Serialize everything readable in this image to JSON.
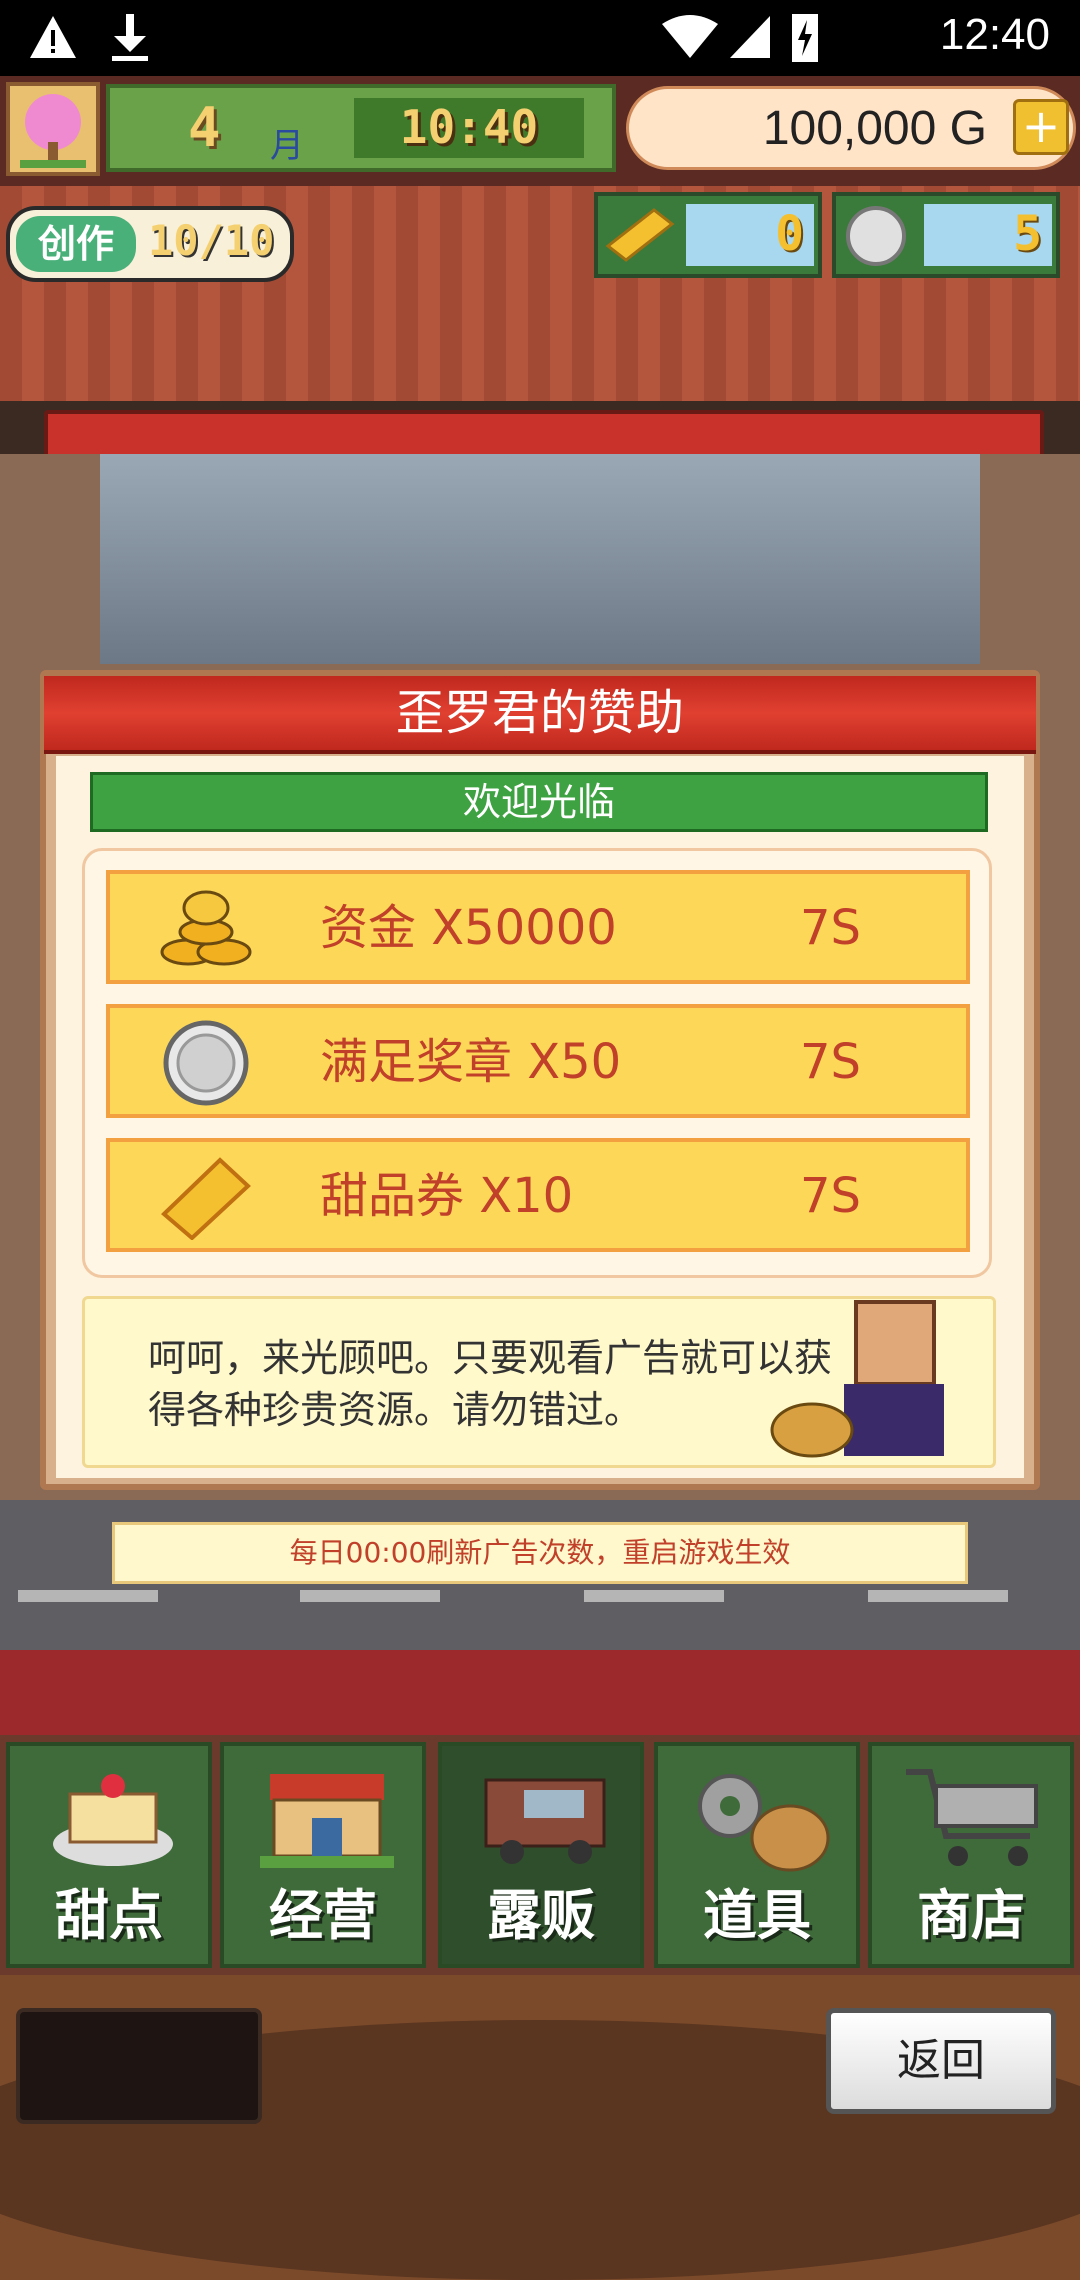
{
  "status_bar": {
    "time": "12:40"
  },
  "hud": {
    "month_value": "4",
    "month_unit": "月",
    "clock": "10:40",
    "gold": "100,000 G",
    "create_label": "创作",
    "create_count": "10/10",
    "ticket_count": "0",
    "medal_count": "5"
  },
  "dialog": {
    "title": "歪罗君的赞助",
    "welcome": "欢迎光临",
    "rewards": [
      {
        "label": "资金 X50000",
        "timer": "7S",
        "icon": "gold-coins-icon"
      },
      {
        "label": "满足奖章 X50",
        "timer": "7S",
        "icon": "silver-medal-icon"
      },
      {
        "label": "甜品券 X10",
        "timer": "7S",
        "icon": "dessert-ticket-icon"
      }
    ],
    "message": "呵呵，来光顾吧。只要观看广告就可以获得各种珍贵资源。请勿错过。"
  },
  "notice": "每日00:00刷新广告次数，重启游戏生效",
  "nav": [
    {
      "label": "甜点",
      "icon": "cake-icon"
    },
    {
      "label": "经营",
      "icon": "shop-icon"
    },
    {
      "label": "露贩",
      "icon": "food-truck-icon"
    },
    {
      "label": "道具",
      "icon": "gear-bag-icon"
    },
    {
      "label": "商店",
      "icon": "cart-icon"
    }
  ],
  "back_label": "返回",
  "colors": {
    "title_red": "#c0281e",
    "reward_yellow": "#fdd858",
    "reward_text": "#c0402a",
    "nav_green": "#3f6a3a"
  }
}
